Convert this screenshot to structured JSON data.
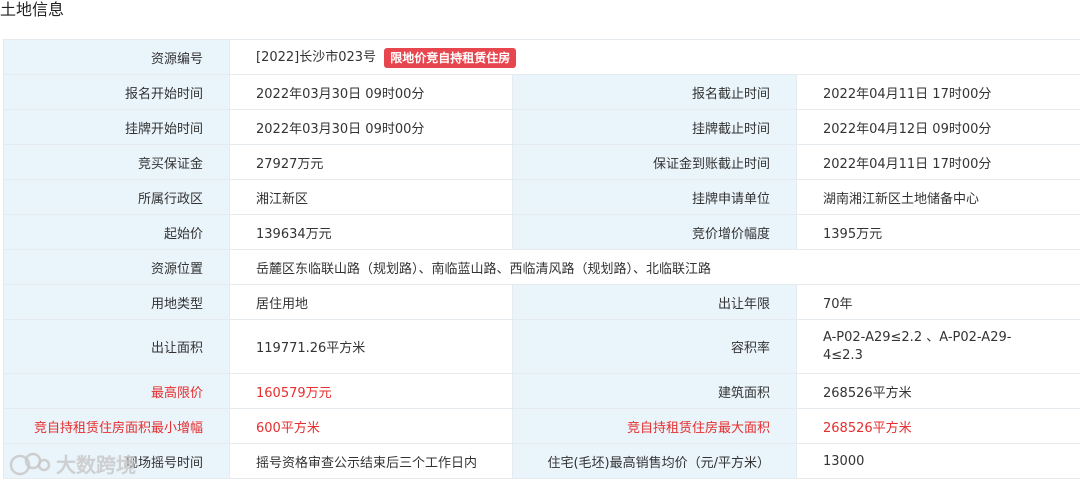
{
  "title": "土地信息",
  "badge": "限地价竞自持租赁住房",
  "watermark": "大数跨境",
  "rows": {
    "r1": {
      "label": "资源编号",
      "value": "[2022]长沙市023号"
    },
    "r2": {
      "l1": "报名开始时间",
      "v1": "2022年03月30日 09时00分",
      "l2": "报名截止时间",
      "v2": "2022年04月11日 17时00分"
    },
    "r3": {
      "l1": "挂牌开始时间",
      "v1": "2022年03月30日 09时00分",
      "l2": "挂牌截止时间",
      "v2": "2022年04月12日 09时00分"
    },
    "r4": {
      "l1": "竞买保证金",
      "v1": "27927万元",
      "l2": "保证金到账截止时间",
      "v2": "2022年04月11日 17时00分"
    },
    "r5": {
      "l1": "所属行政区",
      "v1": "湘江新区",
      "l2": "挂牌申请单位",
      "v2": "湖南湘江新区土地储备中心"
    },
    "r6": {
      "l1": "起始价",
      "v1": "139634万元",
      "l2": "竞价增价幅度",
      "v2": "1395万元"
    },
    "r7": {
      "label": "资源位置",
      "value": "岳麓区东临联山路（规划路）、南临蓝山路、西临清风路（规划路）、北临联江路"
    },
    "r8": {
      "l1": "用地类型",
      "v1": "居住用地",
      "l2": "出让年限",
      "v2": "70年"
    },
    "r9": {
      "l1": "出让面积",
      "v1": "119771.26平方米",
      "l2": "容积率",
      "v2": "A-P02-A29≤2.2 、A-P02-A29-4≤2.3"
    },
    "r10": {
      "l1": "最高限价",
      "v1": "160579万元",
      "l2": "建筑面积",
      "v2": "268526平方米"
    },
    "r11": {
      "l1": "竞自持租赁住房面积最小增幅",
      "v1": "600平方米",
      "l2": "竞自持租赁住房最大面积",
      "v2": "268526平方米"
    },
    "r12": {
      "l1": "现场摇号时间",
      "v1": "摇号资格审查公示结束后三个工作日内",
      "l2": "住宅(毛坯)最高销售均价（元/平方米）",
      "v2": "13000"
    }
  }
}
